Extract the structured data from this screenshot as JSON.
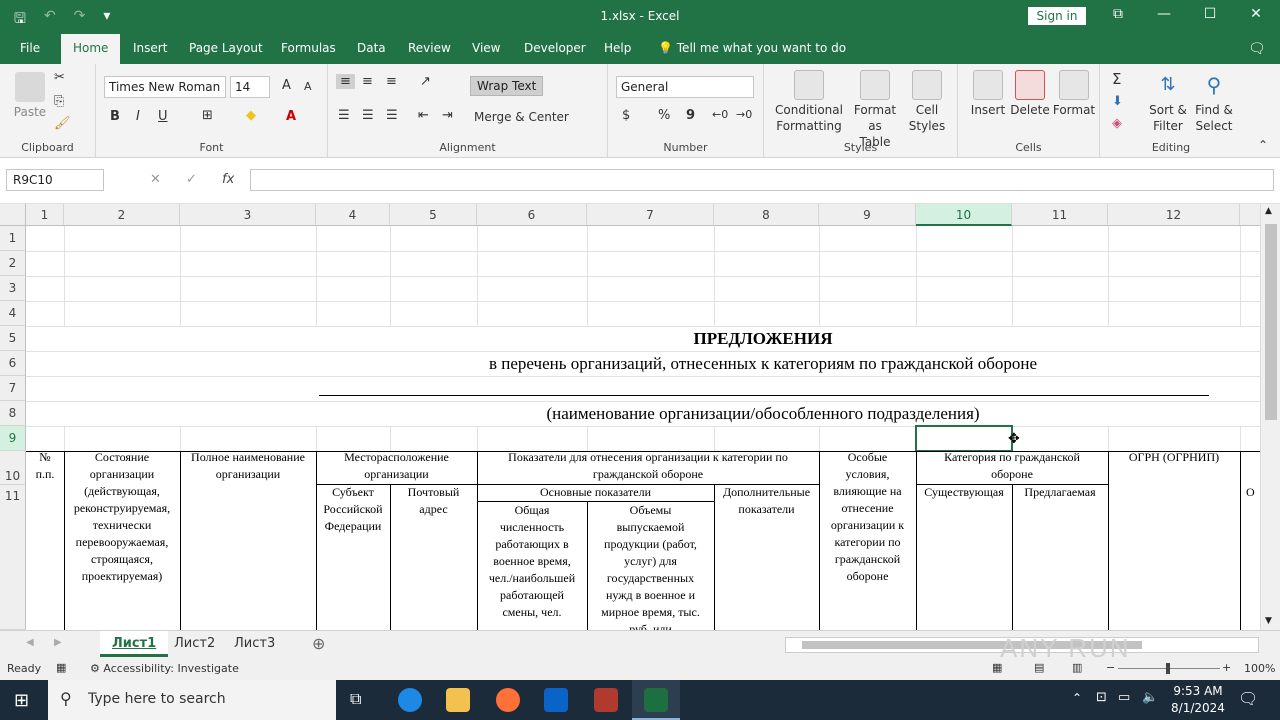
{
  "app": {
    "doc_title": "1.xlsx  -  Excel",
    "sign_in": "Sign in"
  },
  "qat": {
    "save": "🖫",
    "undo": "↶",
    "redo": "↷",
    "more": "▾"
  },
  "window": {
    "restore": "⧉",
    "minimize": "—",
    "maximize": "☐",
    "close": "✕"
  },
  "menu": {
    "tabs": [
      "File",
      "Home",
      "Insert",
      "Page Layout",
      "Formulas",
      "Data",
      "Review",
      "View",
      "Developer",
      "Help"
    ],
    "tell_me": "Tell me what you want to do"
  },
  "ribbon": {
    "clipboard": {
      "paste": "Paste",
      "label": "Clipboard"
    },
    "font": {
      "name": "Times New Roman",
      "size": "14",
      "grow": "A",
      "shrink": "A",
      "bold": "B",
      "italic": "I",
      "underline": "U",
      "color_letter": "A",
      "label": "Font"
    },
    "alignment": {
      "wrap_text": "Wrap Text",
      "merge_center": "Merge & Center",
      "label": "Alignment"
    },
    "number": {
      "format": "General",
      "currency": "$",
      "percent": "%",
      "comma": "9",
      "label": "Number"
    },
    "styles": {
      "conditional": [
        "Conditional",
        "Formatting"
      ],
      "format_table": [
        "Format as",
        "Table"
      ],
      "cell_styles": [
        "Cell",
        "Styles"
      ],
      "label": "Styles"
    },
    "cells": {
      "insert": "Insert",
      "delete": "Delete",
      "format": "Format",
      "label": "Cells"
    },
    "editing": {
      "sort": [
        "Sort &",
        "Filter"
      ],
      "find": [
        "Find &",
        "Select"
      ],
      "label": "Editing"
    }
  },
  "formula_bar": {
    "name_box": "R9C10",
    "cancel": "✕",
    "enter": "✓",
    "fx": "fx",
    "value": ""
  },
  "columns": [
    "1",
    "2",
    "3",
    "4",
    "5",
    "6",
    "7",
    "8",
    "9",
    "10",
    "11",
    "12"
  ],
  "rows": [
    "1",
    "2",
    "3",
    "4",
    "5",
    "6",
    "7",
    "8",
    "9",
    "10",
    "11"
  ],
  "sheet": {
    "title": "ПРЕДЛОЖЕНИЯ",
    "subtitle": "в перечень организаций, отнесенных к категориям по гражданской обороне",
    "org_caption": "(наименование организации/обособленного подразделения)",
    "headers": {
      "num": [
        "№",
        "п.п."
      ],
      "state": [
        "Состояние",
        "организации",
        "(действующая,",
        "реконструируемая,",
        "технически",
        "перевооружаемая,",
        "строящаяся,",
        "проектируемая)"
      ],
      "full_name": [
        "Полное наименование",
        "организации"
      ],
      "location": [
        "Месторасположение",
        "организации"
      ],
      "subject": [
        "Субъект",
        "Российской",
        "Федерации"
      ],
      "postal": [
        "Почтовый",
        "адрес"
      ],
      "indicators": [
        "Показатели для отнесения организации к категории по",
        "гражданской обороне"
      ],
      "main_indicators": "Основные показатели",
      "headcount": [
        "Общая",
        "численность",
        "работающих в",
        "военное время,",
        "чел./наибольшей",
        "работающей",
        "смены, чел."
      ],
      "output": [
        "Объемы",
        "выпускаемой",
        "продукции (работ,",
        "услуг) для",
        "государственных",
        "нужд в военное и",
        "мирное время, тыс.",
        "руб. или"
      ],
      "additional": [
        "Дополнительные",
        "показатели"
      ],
      "special": [
        "Особые",
        "условия,",
        "влияющие на",
        "отнесение",
        "организации к",
        "категории по",
        "гражданской",
        "обороне"
      ],
      "category": [
        "Категория по гражданской",
        "обороне"
      ],
      "existing": "Существующая",
      "proposed": "Предлагаемая",
      "ogrn": "ОГРН (ОГРНИП)",
      "partial": "О"
    }
  },
  "sheet_tabs": [
    "Лист1",
    "Лист2",
    "Лист3"
  ],
  "status": {
    "ready": "Ready",
    "accessibility": "Accessibility: Investigate",
    "zoom": "100%"
  },
  "taskbar": {
    "search": "Type here to search",
    "time": "9:53 AM",
    "date": "8/1/2024"
  },
  "watermark": "ANY RUN",
  "colors": {
    "excel_green": "#217346",
    "taskbar": "#1c2b3a"
  }
}
